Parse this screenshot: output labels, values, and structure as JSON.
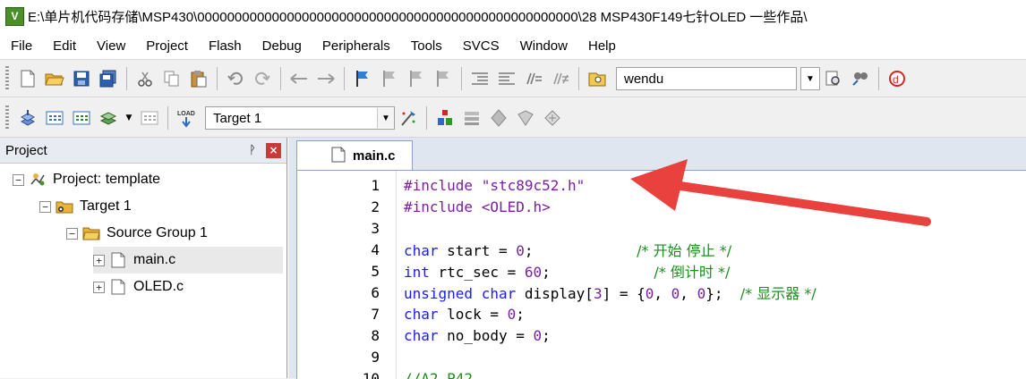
{
  "window": {
    "title": "E:\\单片机代码存储\\MSP430\\000000000000000000000000000000000000000000000000000\\28 MSP430F149七针OLED  一些作品\\",
    "app_icon_label": "V"
  },
  "menu": [
    "File",
    "Edit",
    "View",
    "Project",
    "Flash",
    "Debug",
    "Peripherals",
    "Tools",
    "SVCS",
    "Window",
    "Help"
  ],
  "toolbar1": {
    "find_combo_value": "wendu"
  },
  "toolbar2": {
    "target_combo_value": "Target 1"
  },
  "project_panel": {
    "title": "Project",
    "pin_glyph": "ᚹ",
    "close_glyph": "×",
    "tree": [
      {
        "label": "Project: template",
        "expander": "−",
        "icon": "project-icon"
      },
      {
        "label": "Target 1",
        "expander": "−",
        "icon": "target-folder-icon"
      },
      {
        "label": "Source Group 1",
        "expander": "−",
        "icon": "folder-icon"
      },
      {
        "label": "main.c",
        "expander": "+",
        "icon": "c-file-icon",
        "selected": true
      },
      {
        "label": "OLED.c",
        "expander": "+",
        "icon": "c-file-icon"
      }
    ]
  },
  "editor": {
    "tab_label": "main.c",
    "lines": [
      {
        "n": "1",
        "parts": [
          [
            "pp",
            "#include "
          ],
          [
            "str",
            "\"stc89c52.h\""
          ]
        ]
      },
      {
        "n": "2",
        "parts": [
          [
            "pp",
            "#include "
          ],
          [
            "str",
            "<OLED.h>"
          ]
        ]
      },
      {
        "n": "3",
        "parts": []
      },
      {
        "n": "4",
        "parts": [
          [
            "kw",
            "char"
          ],
          [
            "",
            " start = "
          ],
          [
            "num",
            "0"
          ],
          [
            "",
            ";            "
          ],
          [
            "cm",
            "/* 开始 停止 */"
          ]
        ]
      },
      {
        "n": "5",
        "parts": [
          [
            "kw",
            "int"
          ],
          [
            "",
            " rtc_sec = "
          ],
          [
            "num",
            "60"
          ],
          [
            "",
            ";            "
          ],
          [
            "cm",
            "/* 倒计时 */"
          ]
        ]
      },
      {
        "n": "6",
        "parts": [
          [
            "kw",
            "unsigned"
          ],
          [
            "",
            " "
          ],
          [
            "kw",
            "char"
          ],
          [
            "",
            " display["
          ],
          [
            "num",
            "3"
          ],
          [
            "",
            "] = {"
          ],
          [
            "num",
            "0"
          ],
          [
            "",
            ", "
          ],
          [
            "num",
            "0"
          ],
          [
            "",
            ", "
          ],
          [
            "num",
            "0"
          ],
          [
            "",
            "};  "
          ],
          [
            "cm",
            "/* 显示器 */"
          ]
        ]
      },
      {
        "n": "7",
        "parts": [
          [
            "kw",
            "char"
          ],
          [
            "",
            " lock = "
          ],
          [
            "num",
            "0"
          ],
          [
            "",
            ";"
          ]
        ]
      },
      {
        "n": "8",
        "parts": [
          [
            "kw",
            "char"
          ],
          [
            "",
            " no_body = "
          ],
          [
            "num",
            "0"
          ],
          [
            "",
            ";"
          ]
        ]
      },
      {
        "n": "9",
        "parts": []
      },
      {
        "n": "10",
        "parts": [
          [
            "cm",
            "//A2 P42"
          ]
        ]
      }
    ]
  },
  "colors": {
    "keyword": "#1a1aff",
    "preprocessor": "#7a1fa2",
    "comment": "#1d8c1d",
    "annotation_arrow": "#e8413e"
  }
}
